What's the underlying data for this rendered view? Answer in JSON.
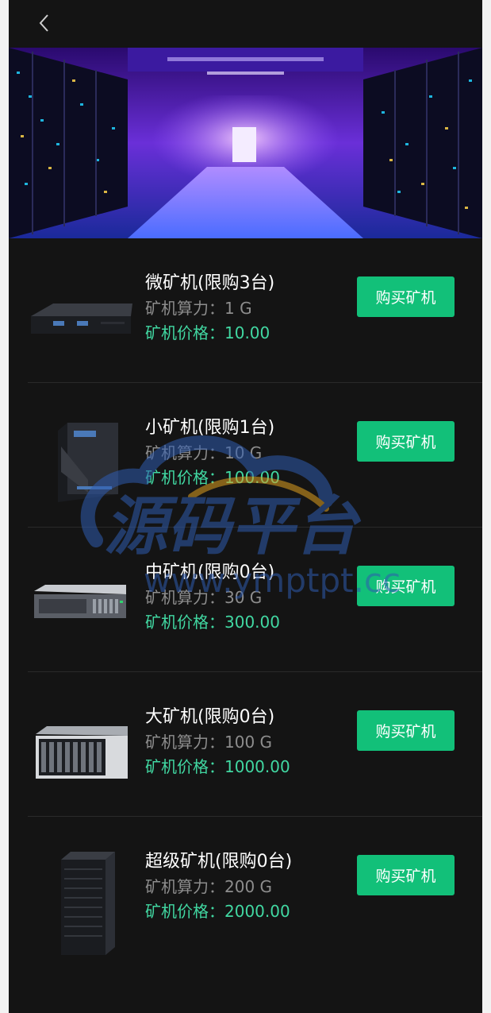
{
  "header": {
    "back_icon": "chevron-left-icon"
  },
  "banner": {
    "image": "data-center-server-aisle"
  },
  "watermark": {
    "text": "源码平台",
    "url": "www.ymptpt.cc"
  },
  "colors": {
    "accent": "#12c079",
    "price": "#41d8a2",
    "background": "#141414"
  },
  "machines": [
    {
      "title": "微矿机(限购3台)",
      "hashrate": "矿机算力：1 G",
      "price": "矿机价格：10.00",
      "button": "购买矿机",
      "image": "micro-miner"
    },
    {
      "title": "小矿机(限购1台)",
      "hashrate": "矿机算力：10 G",
      "price": "矿机价格：100.00",
      "button": "购买矿机",
      "image": "tower-miner"
    },
    {
      "title": "中矿机(限购0台)",
      "hashrate": "矿机算力：30 G",
      "price": "矿机价格：300.00",
      "button": "购买矿机",
      "image": "rack-server"
    },
    {
      "title": "大矿机(限购0台)",
      "hashrate": "矿机算力：100 G",
      "price": "矿机价格：1000.00",
      "button": "购买矿机",
      "image": "blade-chassis"
    },
    {
      "title": "超级矿机(限购0台)",
      "hashrate": "矿机算力：200 G",
      "price": "矿机价格：2000.00",
      "button": "购买矿机",
      "image": "server-cabinet"
    }
  ]
}
